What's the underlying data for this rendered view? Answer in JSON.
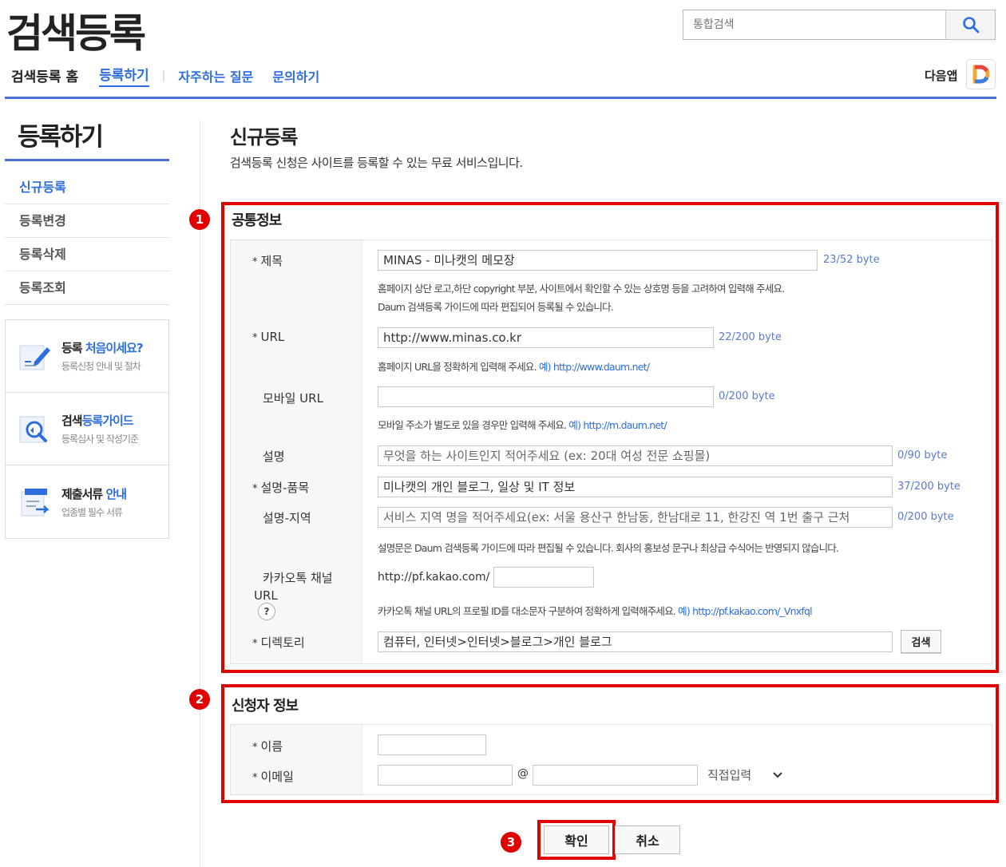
{
  "header": {
    "logo": "검색등록",
    "search_placeholder": "통합검색",
    "nav": {
      "home": "검색등록 홈",
      "register": "등록하기",
      "separator": "|",
      "faq": "자주하는 질문",
      "inquiry": "문의하기"
    },
    "daum_app": "다음앱"
  },
  "sidebar": {
    "title": "등록하기",
    "items": [
      {
        "label": "신규등록",
        "active": true
      },
      {
        "label": "등록변경",
        "active": false
      },
      {
        "label": "등록삭제",
        "active": false
      },
      {
        "label": "등록조회",
        "active": false
      }
    ],
    "boxes": [
      {
        "title_a": "등록 ",
        "title_b": "처음이세요?",
        "sub": "등록신청 안내 및 절차",
        "icon": "pencil-doc-icon"
      },
      {
        "title_a": "검색",
        "title_b": "등록가이드",
        "sub": "등록심사 및 작성기준",
        "icon": "magnifier-doc-icon"
      },
      {
        "title_a": "제출서류 ",
        "title_b": "안내",
        "sub": "업종별 필수 서류",
        "icon": "documents-icon"
      }
    ]
  },
  "main": {
    "title": "신규등록",
    "description": "검색등록 신청은 사이트를 등록할 수 있는 무료 서비스입니다."
  },
  "annotations": {
    "n1": "1",
    "n2": "2",
    "n3": "3",
    "color": "#e00000"
  },
  "common": {
    "section_title": "공통정보",
    "title_label": "제목",
    "title_value": "MINAS - 미나캣의 메모장",
    "title_bytes": "23/52 byte",
    "title_help1": "홈페이지 상단 로고,하단 copyright 부분, 사이트에서 확인할 수 있는 상호명 등을 고려하여 입력해 주세요.",
    "title_help2": "Daum 검색등록 가이드에 따라 편집되어 등록될 수 있습니다.",
    "url_label": "URL",
    "url_value": "http://www.minas.co.kr",
    "url_bytes": "22/200 byte",
    "url_help": "홈페이지 URL을 정확하게 입력해 주세요.",
    "url_example": "예) http://www.daum.net/",
    "mobile_label": "모바일 URL",
    "mobile_value": "",
    "mobile_bytes": "0/200 byte",
    "mobile_help": "모바일 주소가 별도로 있을 경우만 입력해 주세요.",
    "mobile_example": "예) http://m.daum.net/",
    "desc_label": "설명",
    "desc_placeholder": "무엇을 하는 사이트인지 적어주세요 (ex: 20대 여성 전문 쇼핑몰)",
    "desc_bytes": "0/90 byte",
    "item_label": "설명-품목",
    "item_value": "미나캣의 개인 블로그, 일상 및 IT 정보",
    "item_bytes": "37/200 byte",
    "region_label": "설명-지역",
    "region_placeholder": "서비스 지역 명을 적어주세요(ex: 서울  용산구 한남동, 한남대로 11, 한강진 역 1번 출구 근처",
    "region_bytes": "0/200 byte",
    "desc_help": "설명문은 Daum 검색등록 가이드에 따라 편집될 수 있습니다. 회사의 홍보성 문구나 최상급 수식어는 반영되지 않습니다.",
    "kakao_label_1": "카카오톡 채널",
    "kakao_label_2": "URL",
    "kakao_help_icon": "?",
    "kakao_prefix": "http://pf.kakao.com/",
    "kakao_value": "",
    "kakao_help": "카카오톡 채널 URL의 프로필 ID를 대소문자 구분하여 정확하게 입력해주세요.",
    "kakao_example": "예) http://pf.kakao.com/_Vnxfql",
    "dir_label": "디렉토리",
    "dir_value": "컴퓨터, 인터넷>인터넷>블로그>개인 블로그",
    "dir_button": "검색",
    "required_mark": "*"
  },
  "applicant": {
    "section_title": "신청자 정보",
    "name_label": "이름",
    "name_value": "",
    "email_label": "이메일",
    "email_local": "",
    "email_at": "@",
    "email_domain": "",
    "email_select": "직접입력",
    "required_mark": "*"
  },
  "actions": {
    "confirm": "확인",
    "cancel": "취소"
  }
}
